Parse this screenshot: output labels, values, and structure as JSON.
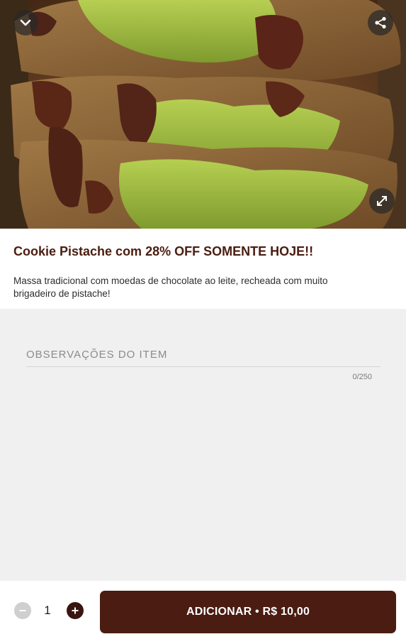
{
  "icons": {
    "collapse": "chevron-down-icon",
    "share": "share-icon",
    "expand": "expand-icon",
    "minus": "minus-icon",
    "plus": "plus-icon"
  },
  "colors": {
    "brand": "#4a1c12",
    "title": "#4a1d10",
    "pistachio": "#9ab842",
    "chocolate": "#5a2a1c"
  },
  "product": {
    "title": "Cookie Pistache com 28% OFF SOMENTE HOJE!!",
    "description": "Massa tradicional com moedas de chocolate ao leite, recheada com muito brigadeiro de pistache!"
  },
  "notes": {
    "label": "OBSERVAÇÕES DO ITEM",
    "counter": "0/250"
  },
  "cart": {
    "quantity": "1",
    "add_label": "ADICIONAR • R$ 10,00"
  }
}
